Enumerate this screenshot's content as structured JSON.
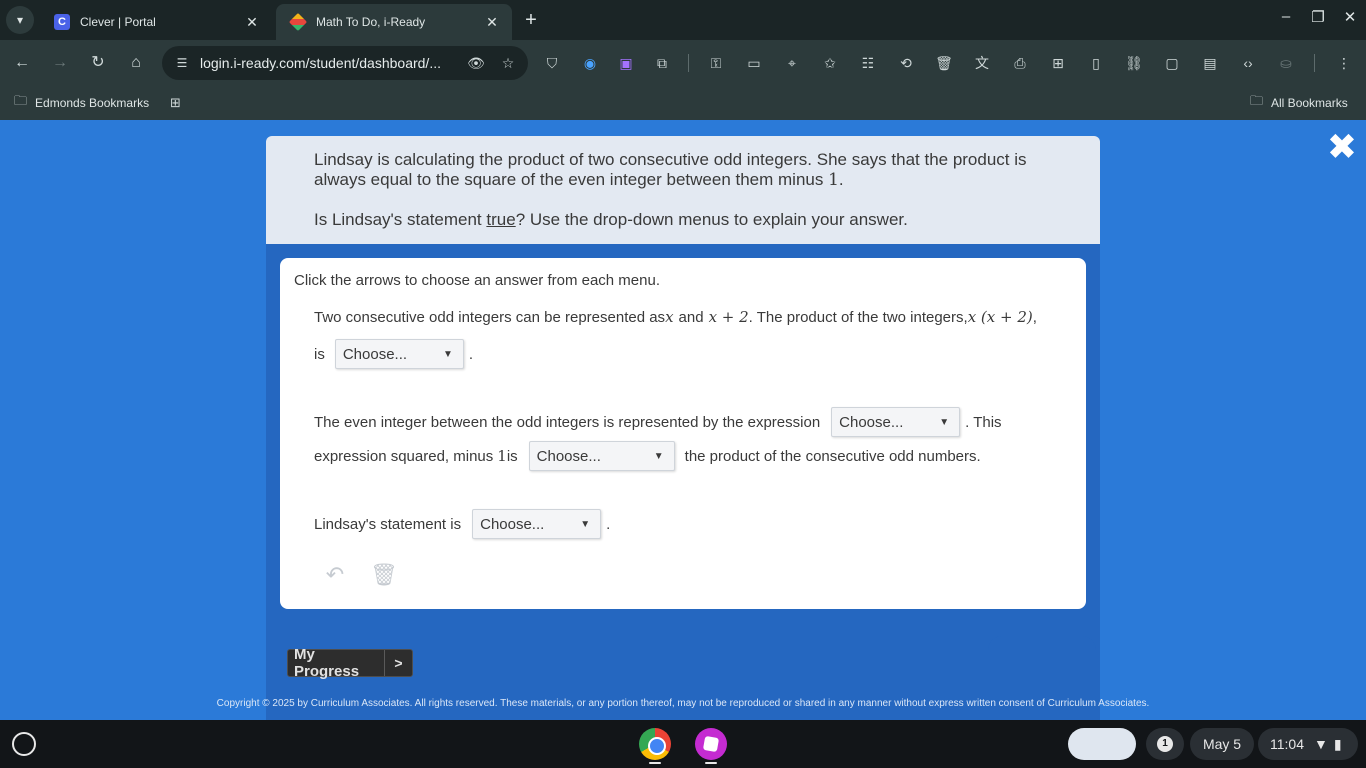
{
  "browser": {
    "tabs": [
      {
        "title": "Clever | Portal",
        "favicon_letter": "C"
      },
      {
        "title": "Math To Do, i-Ready"
      }
    ],
    "url": "login.i-ready.com/student/dashboard/...",
    "bookmarks": {
      "left": "Edmonds Bookmarks",
      "right": "All Bookmarks"
    }
  },
  "question": {
    "prompt_line1": "Lindsay is calculating the product of two consecutive odd integers. She says that the product is",
    "prompt_line2": "always equal to the square of the even integer between them minus ",
    "prompt_one": "1",
    "prompt_period": ".",
    "ask_prefix": "Is Lindsay's statement ",
    "ask_true": "true",
    "ask_suffix": "? Use the drop-down menus to explain your answer.",
    "instruction": "Click the arrows to choose an answer from each menu.",
    "p1a": "Two consecutive odd integers can be represented as ",
    "p1_x": "x",
    "p1_and": " and ",
    "p1_x2": "x + 2",
    "p1b": ". The product of the two integers, ",
    "p1_expr": "x (x + 2)",
    "p1c": ",",
    "p1_is": "is",
    "p2a": "The even integer between the odd integers is represented by the expression",
    "p2b": ". This",
    "p2c": "expression squared, minus ",
    "p2_one": "1",
    "p2d": " is",
    "p2e": "the product of the consecutive odd numbers.",
    "p3a": "Lindsay's statement is",
    "period": ".",
    "dropdown_placeholder": "Choose..."
  },
  "footer": {
    "progress_label": "My Progress",
    "progress_arrow": ">",
    "copyright": "Copyright © 2025 by Curriculum Associates. All rights reserved. These materials, or any portion thereof, may not be reproduced or shared in any manner without express written consent of Curriculum Associates."
  },
  "shelf": {
    "notification_count": "1",
    "date": "May 5",
    "time": "11:04"
  },
  "colors": {
    "page_background": "#2b7ad8",
    "prompt_background": "#e3e9f2",
    "chrome_background": "#2c3a3b"
  }
}
